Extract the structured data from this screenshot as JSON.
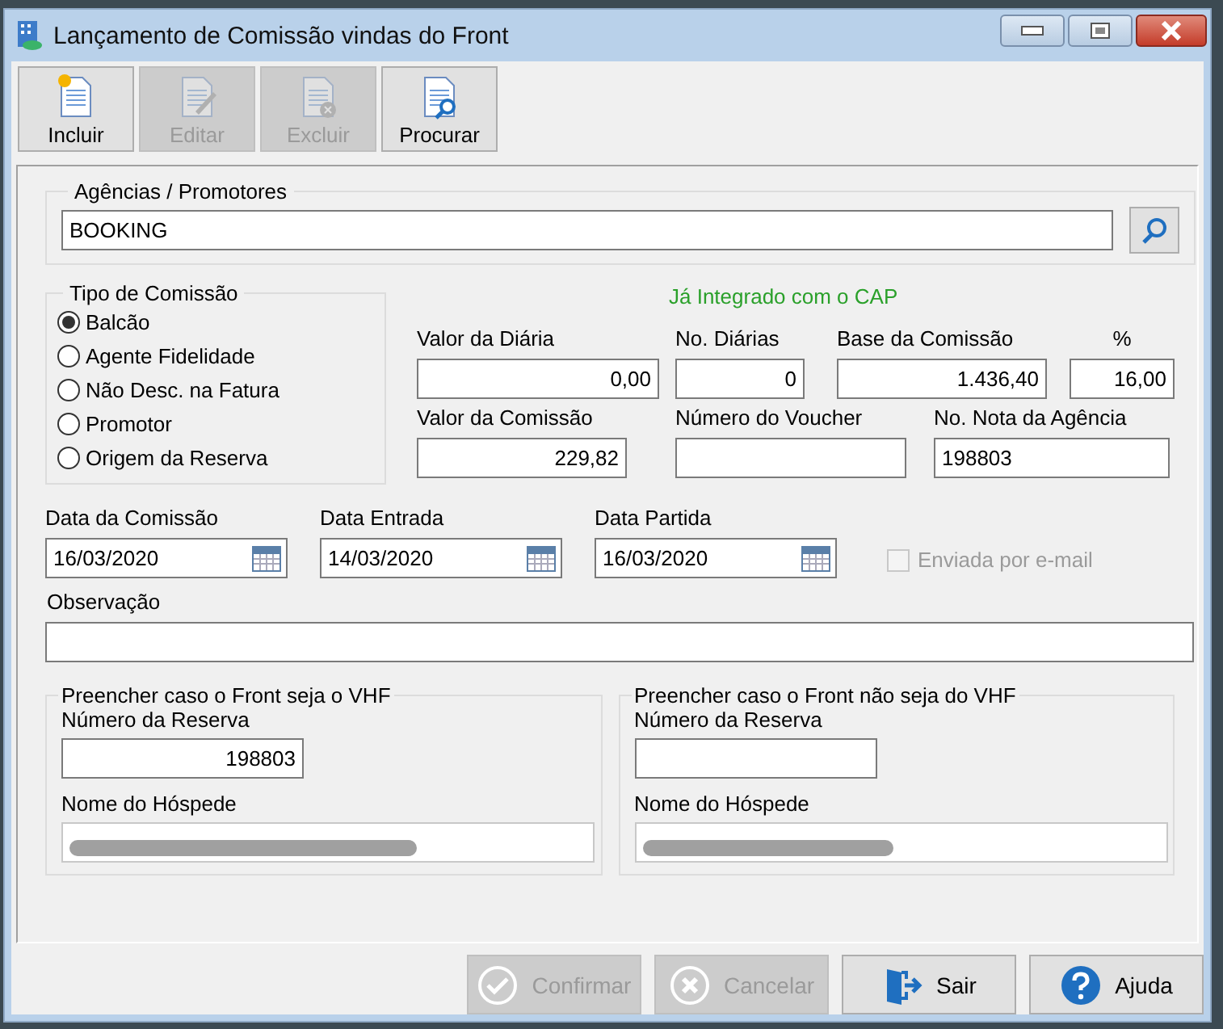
{
  "window": {
    "title": "Lançamento de Comissão vindas do Front"
  },
  "toolbar": [
    {
      "label": "Incluir",
      "kind": "new",
      "disabled": false
    },
    {
      "label": "Editar",
      "kind": "edit",
      "disabled": true
    },
    {
      "label": "Excluir",
      "kind": "delete",
      "disabled": true
    },
    {
      "label": "Procurar",
      "kind": "find",
      "disabled": false
    }
  ],
  "agencias": {
    "title": "Agências / Promotores",
    "value": "BOOKING"
  },
  "tipo_comissao": {
    "title": "Tipo de Comissão",
    "options": [
      {
        "label": "Balcão",
        "selected": true
      },
      {
        "label": "Agente Fidelidade",
        "selected": false
      },
      {
        "label": "Não Desc. na Fatura",
        "selected": false
      },
      {
        "label": "Promotor",
        "selected": false
      },
      {
        "label": "Origem da Reserva",
        "selected": false
      }
    ]
  },
  "status_text": "Já Integrado com o CAP",
  "value_rows": [
    [
      {
        "label": "Valor da Diária",
        "value": "0,00"
      },
      {
        "label": "No. Diárias",
        "value": "0"
      },
      {
        "label": "Base da Comissão",
        "value": "1.436,40"
      },
      {
        "label": "%",
        "value": "16,00"
      }
    ],
    [
      {
        "label": "Valor da Comissão",
        "value": "229,82"
      },
      {
        "label": "Número do Voucher"
      },
      {
        "label": "No. Nota da Agência",
        "value": "198803"
      }
    ]
  ],
  "dates": [
    {
      "label": "Data da Comissão",
      "value": "16/03/2020"
    },
    {
      "label": "Data Entrada",
      "value": "14/03/2020"
    },
    {
      "label": "Data Partida",
      "value": "16/03/2020"
    }
  ],
  "email": {
    "label": "Enviada por e-mail",
    "checked": false,
    "disabled": true
  },
  "observacao": {
    "label": "Observação"
  },
  "groups": [
    {
      "title": "Preencher caso o Front seja o VHF",
      "reserva_label": "Número da Reserva",
      "reserva_value": "198803",
      "hospede_label": "Nome do Hóspede"
    },
    {
      "title": "Preencher caso o Front não seja do VHF",
      "reserva_label": "Número da Reserva",
      "hospede_label": "Nome do Hóspede"
    }
  ],
  "footer_buttons": [
    {
      "label": "Confirmar",
      "kind": "confirm",
      "disabled": true
    },
    {
      "label": "Cancelar",
      "kind": "cancel",
      "disabled": true
    },
    {
      "label": "Sair",
      "kind": "exit",
      "disabled": false
    },
    {
      "label": "Ajuda",
      "kind": "help",
      "disabled": false
    }
  ]
}
